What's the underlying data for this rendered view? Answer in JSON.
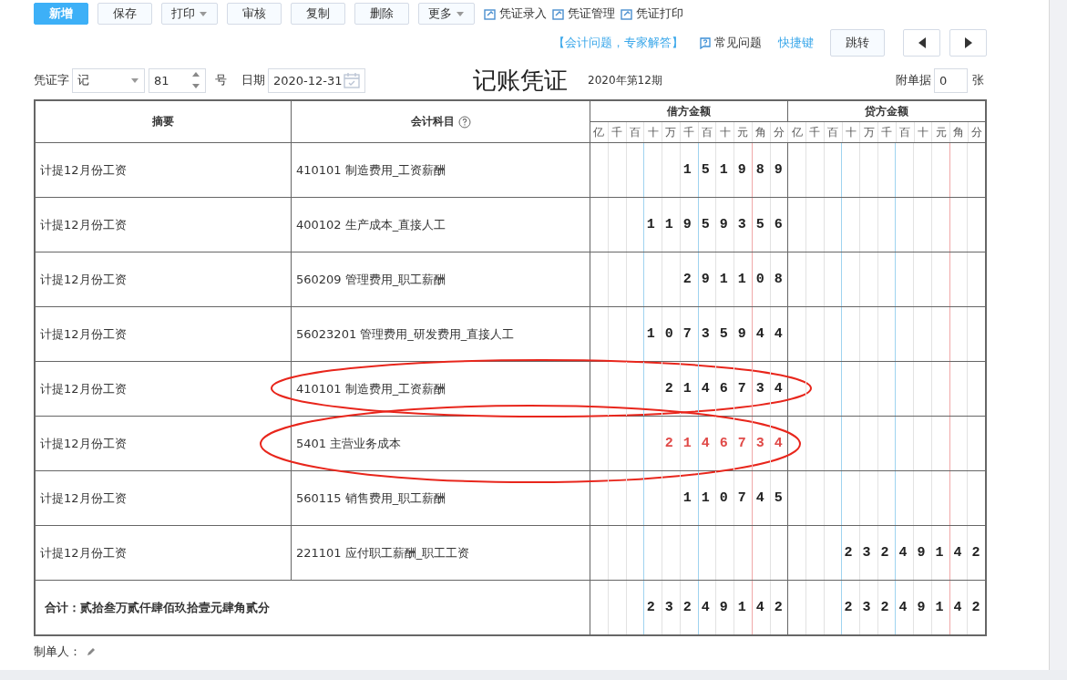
{
  "toolbar": {
    "buttons": [
      {
        "label": "新增",
        "kind": "primary"
      },
      {
        "label": "保存",
        "kind": "plain"
      },
      {
        "label": "打印",
        "kind": "dropdown"
      },
      {
        "label": "审核",
        "kind": "plain"
      },
      {
        "label": "复制",
        "kind": "plain"
      },
      {
        "label": "删除",
        "kind": "plain"
      },
      {
        "label": "更多",
        "kind": "dropdown"
      }
    ],
    "links": [
      "凭证录入",
      "凭证管理",
      "凭证打印"
    ]
  },
  "help_bar": {
    "expert_link": "【会计问题，专家解答】",
    "faq": "常见问题",
    "shortcuts": "快捷键",
    "jump_button": "跳转"
  },
  "header": {
    "voucher_label": "凭证字",
    "voucher_type": "记",
    "number": "81",
    "number_suffix": "号",
    "date_label": "日期",
    "date": "2020-12-31",
    "title": "记账凭证",
    "period": "2020年第12期",
    "attachments_label": "附单据",
    "attachments": "0",
    "attachments_suffix": "张"
  },
  "table": {
    "columns": {
      "summary": "摘要",
      "account": "会计科目",
      "debit": "借方金额",
      "credit": "贷方金额",
      "debit_units": [
        "亿",
        "千",
        "百",
        "十",
        "万",
        "千",
        "百",
        "十",
        "元",
        "角",
        "分"
      ],
      "credit_units": [
        "亿",
        "千",
        "百",
        "十",
        "万",
        "千",
        "百",
        "十",
        "元",
        "角",
        "分"
      ]
    },
    "rows": [
      {
        "summary": "计提12月份工资",
        "account": "410101 制造费用_工资薪酬",
        "debit": "151989",
        "credit": "",
        "circled": false,
        "highlighted": false
      },
      {
        "summary": "计提12月份工资",
        "account": "400102 生产成本_直接人工",
        "debit": "11959356",
        "credit": "",
        "circled": false,
        "highlighted": false
      },
      {
        "summary": "计提12月份工资",
        "account": "560209 管理费用_职工薪酬",
        "debit": "291108",
        "credit": "",
        "circled": false,
        "highlighted": false
      },
      {
        "summary": "计提12月份工资",
        "account": "56023201 管理费用_研发费用_直接人工",
        "debit": "10735944",
        "credit": "",
        "circled": false,
        "highlighted": false
      },
      {
        "summary": "计提12月份工资",
        "account": "410101 制造费用_工资薪酬",
        "debit": "2146734",
        "credit": "",
        "circled": true,
        "highlighted": false
      },
      {
        "summary": "计提12月份工资",
        "account": "5401 主营业务成本",
        "debit": "2146734",
        "credit": "",
        "circled": true,
        "highlighted": true
      },
      {
        "summary": "计提12月份工资",
        "account": "560115 销售费用_职工薪酬",
        "debit": "110745",
        "credit": "",
        "circled": false,
        "highlighted": false
      },
      {
        "summary": "计提12月份工资",
        "account": "221101 应付职工薪酬_职工工资",
        "debit": "",
        "credit": "23249142",
        "circled": false,
        "highlighted": false
      }
    ],
    "total": {
      "label": "合计：贰拾叁万贰仟肆佰玖拾壹元肆角贰分",
      "debit": "23249142",
      "credit": "23249142"
    }
  },
  "footer": {
    "preparer_label": "制单人："
  }
}
